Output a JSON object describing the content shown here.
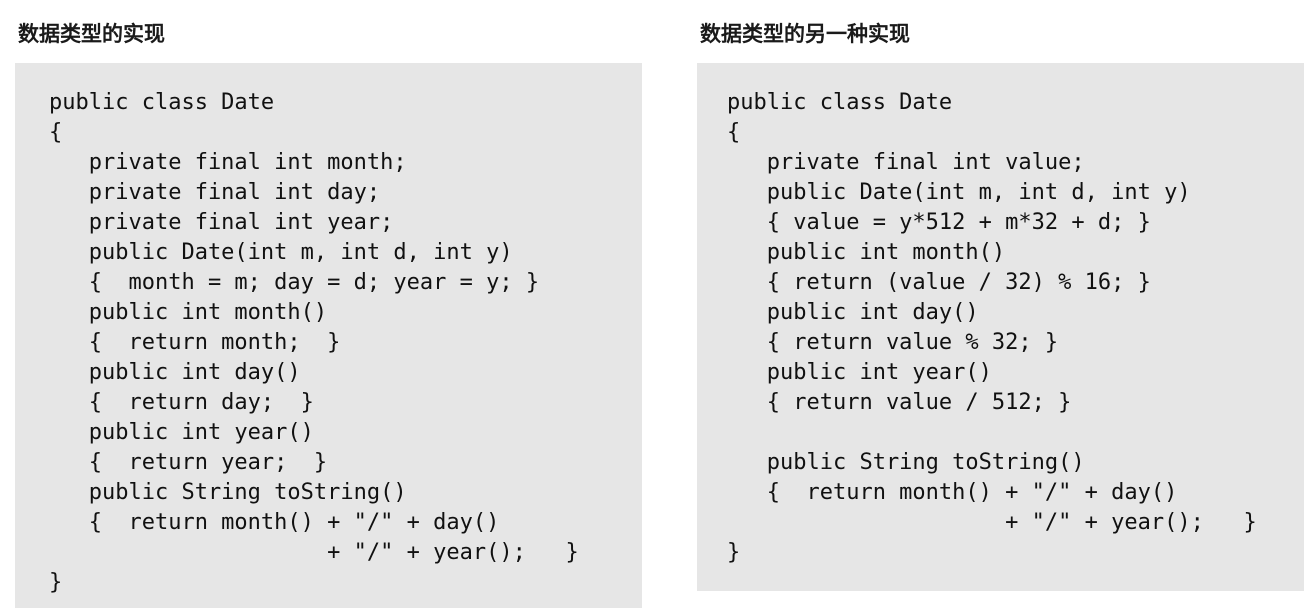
{
  "left": {
    "title": "数据类型的实现",
    "lines": [
      "public class Date",
      "{",
      "   private final int month;",
      "   private final int day;",
      "   private final int year;",
      "   public Date(int m, int d, int y)",
      "   {  month = m; day = d; year = y; }",
      "   public int month()",
      "   {  return month;  }",
      "   public int day()",
      "   {  return day;  }",
      "   public int year()",
      "   {  return year;  }",
      "   public String toString()",
      "   {  return month() + \"/\" + day()",
      "                     + \"/\" + year();   }",
      "}"
    ]
  },
  "right": {
    "title": "数据类型的另一种实现",
    "lines": [
      "public class Date",
      "{",
      "   private final int value;",
      "   public Date(int m, int d, int y)",
      "   { value = y*512 + m*32 + d; }",
      "   public int month()",
      "   { return (value / 32) % 16; }",
      "   public int day()",
      "   { return value % 32; }",
      "   public int year()",
      "   { return value / 512; }",
      "",
      "   public String toString()",
      "   {  return month() + \"/\" + day()",
      "                     + \"/\" + year();   }",
      "}"
    ]
  }
}
